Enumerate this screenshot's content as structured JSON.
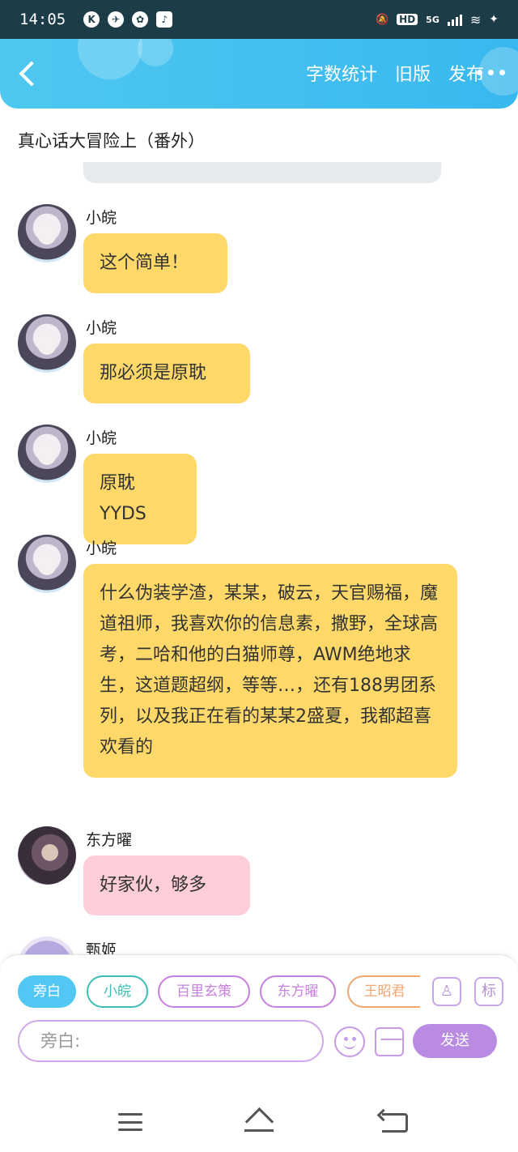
{
  "status_bar": {
    "time": "14:05",
    "hd_label": "HD",
    "network_label": "5G",
    "icons": [
      "kuaishou-icon",
      "compass-icon",
      "baidu-icon",
      "tiktok-icon",
      "mute-icon",
      "signal-icon",
      "wifi-icon",
      "battery-icon"
    ]
  },
  "header": {
    "back_icon": "chevron-left-icon",
    "links": [
      "字数统计",
      "旧版",
      "发布"
    ],
    "more_icon": "more-dots-icon",
    "background_color": "#3fbef0"
  },
  "document_title": "真心话大冒险上（番外）",
  "messages": [
    {
      "speaker": "小皖",
      "text": "这个简单！",
      "bubble_color": "#fed96a"
    },
    {
      "speaker": "小皖",
      "text": "那必须是原耽",
      "bubble_color": "#fed96a"
    },
    {
      "speaker": "小皖",
      "text": "原耽YYDS",
      "bubble_color": "#fed96a"
    },
    {
      "speaker": "小皖",
      "text": "什么伪装学渣，某某，破云，天官赐福，魔道祖师，我喜欢你的信息素，撒野，全球高考，二哈和他的白猫师尊，AWM绝地求生，这道题超纲，等等…，还有188男团系列，以及我正在看的某某2盛夏，我都超喜欢看的",
      "bubble_color": "#fed96a"
    },
    {
      "speaker": "东方曜",
      "text": "好家伙，够多",
      "bubble_color": "#fdcdd9"
    },
    {
      "speaker": "甄姬",
      "text": ""
    }
  ],
  "role_chips": [
    {
      "label": "旁白",
      "active": true,
      "color": "#52c7f3"
    },
    {
      "label": "小皖",
      "active": false,
      "color": "#3cbcb4"
    },
    {
      "label": "百里玄策",
      "active": false,
      "color": "#c77fe0"
    },
    {
      "label": "东方曜",
      "active": false,
      "color": "#c77fe0"
    },
    {
      "label": "王昭君",
      "active": false,
      "color": "#f0a670"
    }
  ],
  "side_buttons": {
    "contact_icon": "contact-card-icon",
    "mark_label": "标"
  },
  "composer": {
    "placeholder": "旁白:",
    "emoji_icon": "emoji-icon",
    "image_icon": "image-icon",
    "send_label": "发送"
  },
  "nav_bar": {
    "icons": [
      "menu-icon",
      "home-icon",
      "back-icon"
    ]
  }
}
